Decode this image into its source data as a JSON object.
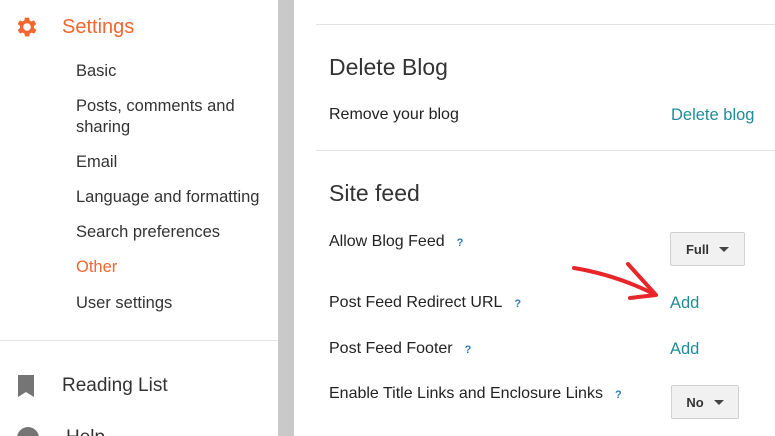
{
  "sidebar": {
    "settings_label": "Settings",
    "items": [
      {
        "label": "Basic"
      },
      {
        "label": "Posts, comments and"
      },
      {
        "label": "sharing"
      },
      {
        "label": "Email"
      },
      {
        "label": "Language and formatting"
      },
      {
        "label": "Search preferences"
      },
      {
        "label": "Other"
      },
      {
        "label": "User settings"
      }
    ],
    "reading_list_label": "Reading List",
    "help_label": "Help"
  },
  "main": {
    "delete_blog": {
      "heading": "Delete Blog",
      "row_label": "Remove your blog",
      "link": "Delete blog"
    },
    "site_feed": {
      "heading": "Site feed",
      "allow_feed_label": "Allow Blog Feed",
      "allow_feed_value": "Full",
      "redirect_label": "Post Feed Redirect URL",
      "redirect_link": "Add",
      "footer_label": "Post Feed Footer",
      "footer_link": "Add",
      "title_links_label": "Enable Title Links and Enclosure Links",
      "title_links_value": "No",
      "help_mark": "?"
    }
  },
  "colors": {
    "accent": "#f4662f",
    "link": "#1f8c98",
    "annotation_arrow": "#e8262a"
  },
  "icons": {
    "settings": "gear-icon",
    "reading_list": "bookmark-icon",
    "help": "help-circle-icon",
    "dropdown": "caret-down-icon",
    "annotation": "red-arrow-annotation"
  }
}
